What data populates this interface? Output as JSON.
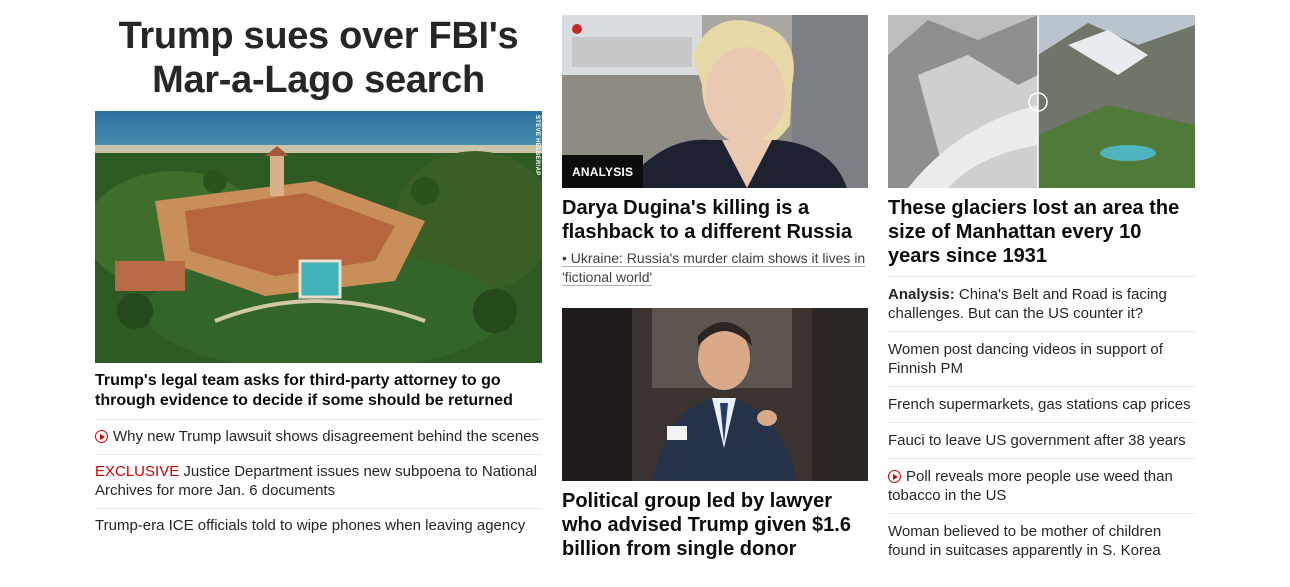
{
  "lead": {
    "banner": "Trump sues over FBI's Mar-a-Lago search",
    "photo_credit": "STEVE HELBER/AP",
    "headline": "Trump's legal team asks for third-party attorney to go through evidence to decide if some should be returned",
    "links": [
      {
        "prefix": "",
        "text": "Why new Trump lawsuit shows disagreement behind the scenes",
        "video": true
      },
      {
        "prefix": "EXCLUSIVE",
        "text": " Justice Department issues new subpoena to National Archives for more Jan. 6 documents",
        "video": false
      },
      {
        "prefix": "",
        "text": "Trump-era ICE officials told to wipe phones when leaving agency",
        "video": false
      }
    ]
  },
  "middle": {
    "card1": {
      "label": "ANALYSIS",
      "headline": "Darya Dugina's killing is a flashback to a different Russia",
      "sublink": "• Ukraine: Russia's murder claim shows it lives in 'fictional world'"
    },
    "card2": {
      "headline": "Political group led by lawyer who advised Trump given $1.6 billion from single donor"
    }
  },
  "right": {
    "card": {
      "headline": "These glaciers lost an area the size of Manhattan every 10 years since 1931"
    },
    "links": [
      {
        "label": "Analysis:",
        "text": " China's Belt and Road is facing challenges. But can the US counter it?",
        "video": false
      },
      {
        "label": "",
        "text": "Women post dancing videos in support of Finnish PM",
        "video": false
      },
      {
        "label": "",
        "text": "French supermarkets, gas stations cap prices",
        "video": false
      },
      {
        "label": "",
        "text": "Fauci to leave US government after 38 years",
        "video": false
      },
      {
        "label": "",
        "text": "Poll reveals more people use weed than tobacco in the US",
        "video": true
      },
      {
        "label": "",
        "text": "Woman believed to be mother of children found in suitcases apparently in S. Korea",
        "video": false
      }
    ]
  },
  "colors": {
    "accent_red": "#cc0000",
    "text": "#0c0c0c",
    "divider": "#e6e6e6"
  }
}
